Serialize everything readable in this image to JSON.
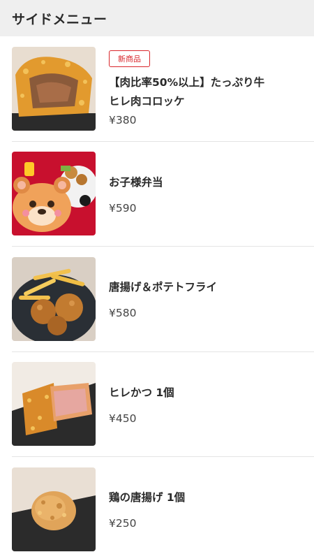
{
  "header": {
    "title": "サイドメニュー"
  },
  "items": [
    {
      "badge": "新商品",
      "name_line1": "【肉比率50%以上】たっぷり牛",
      "name_line2": "ヒレ肉コロッケ",
      "price": "¥380",
      "image": "croquette-image"
    },
    {
      "name": "お子様弁当",
      "price": "¥590",
      "image": "kids-bento-image"
    },
    {
      "name": "唐揚げ＆ポテトフライ",
      "price": "¥580",
      "image": "karaage-fries-image"
    },
    {
      "name": "ヒレかつ 1個",
      "price": "¥450",
      "image": "hirekatsu-image"
    },
    {
      "name": "鶏の唐揚げ 1個",
      "price": "¥250",
      "image": "chicken-karaage-image"
    }
  ]
}
